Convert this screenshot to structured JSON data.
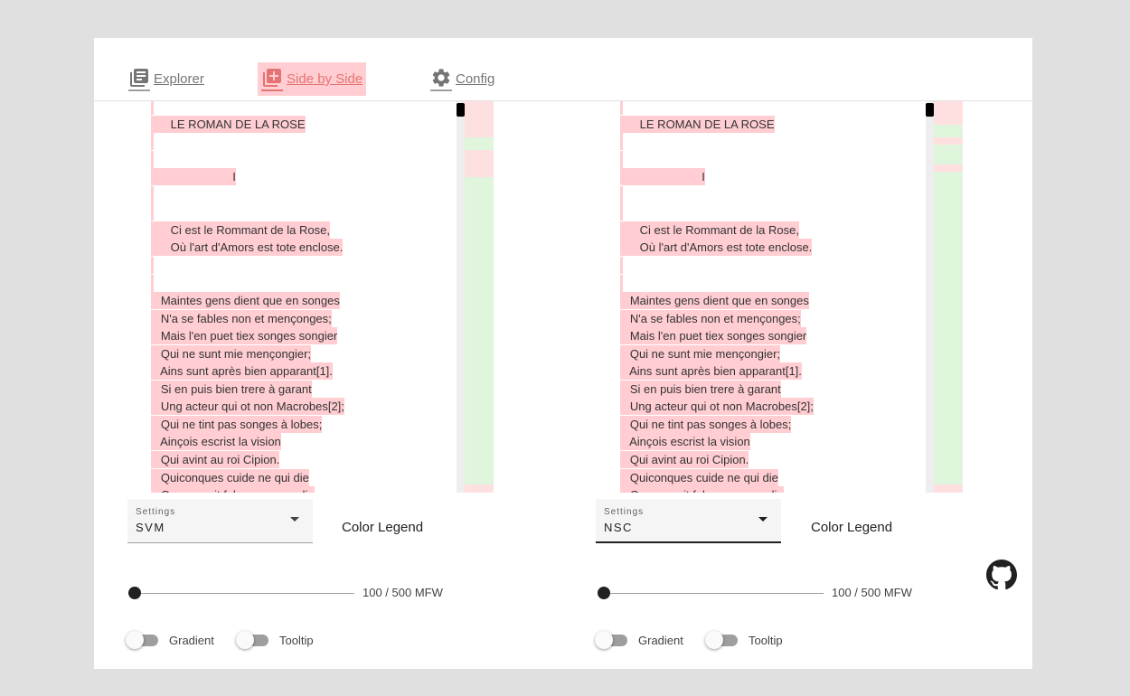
{
  "nav": {
    "tabs": [
      {
        "label": " Explorer",
        "icon": "library-books-icon",
        "active": false
      },
      {
        "label": " Side by Side",
        "icon": "library-add-icon",
        "active": true
      },
      {
        "label": " Config",
        "icon": "gear-icon",
        "active": false
      }
    ]
  },
  "text_lines": [
    "",
    "      LE ROMAN DE LA ROSE",
    "",
    "",
    "                         I",
    "",
    "",
    "      Ci est le Rommant de la Rose,",
    "      Où l'art d'Amors est tote enclose.",
    "",
    "",
    "   Maintes gens dient que en songes",
    "   N'a se fables non et mençonges;",
    "   Mais l'en puet tiex songes songier",
    "   Qui ne sunt mie mençongier;",
    "   Ains sunt après bien apparant[1].",
    "   Si en puis bien trere à garant",
    "   Ung acteur qui ot non Macrobes[2];",
    "   Qui ne tint pas songes à lobes;",
    "   Ainçois escrist la vision",
    "   Qui avint au roi Cipion.",
    "   Quiconques cuide ne qui die",
    "   Que ce soit folor ou musardie"
  ],
  "panels": [
    {
      "settings_caption": "Settings",
      "settings_value": "SVM",
      "color_legend": "Color Legend",
      "slider_label": "100 / 500 MFW",
      "slider_value": 0.0,
      "gradient_label": "Gradient",
      "tooltip_label": "Tooltip",
      "gradient_on": false,
      "tooltip_on": false
    },
    {
      "settings_caption": "Settings",
      "settings_value": "NSC",
      "color_legend": "Color Legend",
      "slider_label": "100 / 500 MFW",
      "slider_value": 0.0,
      "gradient_label": "Gradient",
      "tooltip_label": "Tooltip",
      "gradient_on": false,
      "tooltip_on": false
    }
  ],
  "colors": {
    "highlight": "#ffcdd2",
    "minimap_red": "#ffe0e0",
    "minimap_green": "#dff5dc",
    "active_tab_text": "#e57373"
  },
  "github_icon": "github-icon"
}
